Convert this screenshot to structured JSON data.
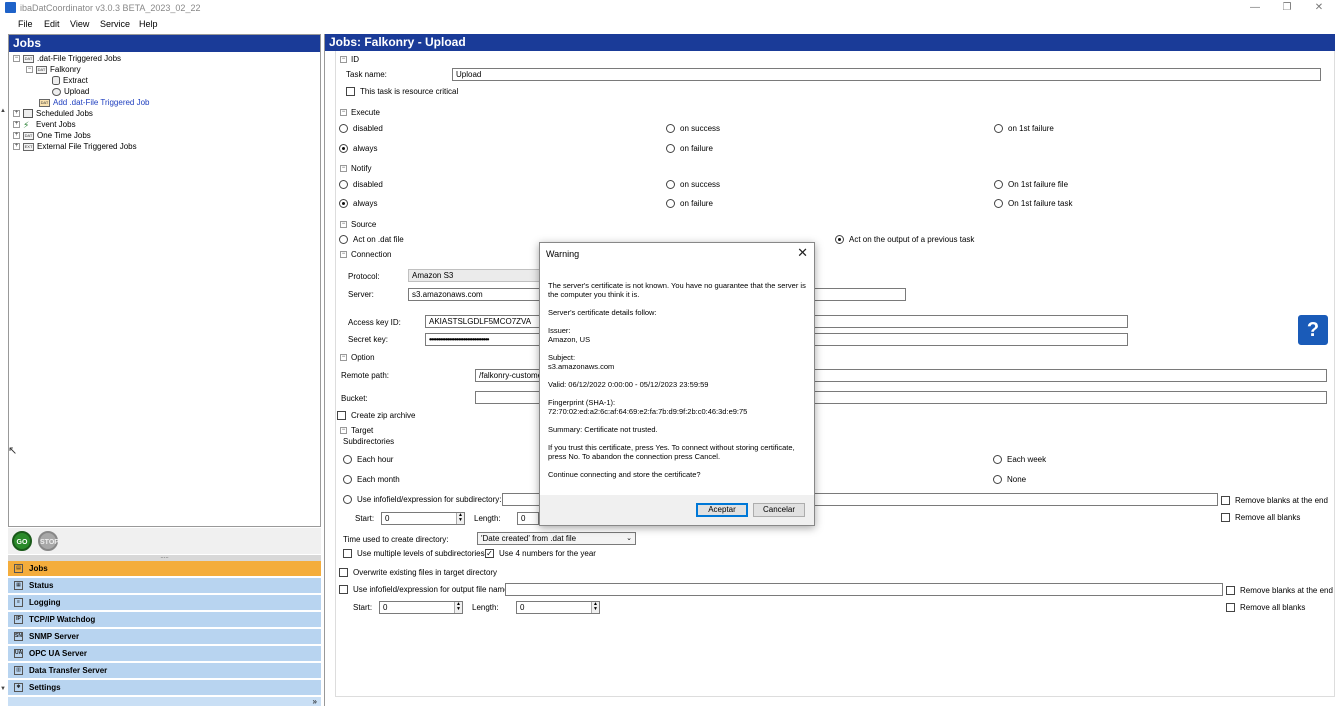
{
  "window": {
    "title": "ibaDatCoordinator v3.0.3 BETA_2023_02_22",
    "minimize": "—",
    "maximize": "❐",
    "close": "✕"
  },
  "menu": [
    "File",
    "Edit",
    "View",
    "Service",
    "Help"
  ],
  "left": {
    "header": "Jobs",
    "tree": [
      {
        "label": ".dat-File Triggered Jobs",
        "icon": "DAT"
      },
      {
        "label": "Falkonry",
        "icon": "DAT"
      },
      {
        "label": "Extract",
        "icon": ""
      },
      {
        "label": "Upload",
        "icon": ""
      },
      {
        "label": "Add .dat-File Triggered Job",
        "icon": "DAT"
      },
      {
        "label": "Scheduled Jobs",
        "icon": ""
      },
      {
        "label": "Event Jobs",
        "icon": ""
      },
      {
        "label": "One Time Jobs",
        "icon": "DAT"
      },
      {
        "label": "External File Triggered Jobs",
        "icon": "EXT"
      }
    ],
    "go_label": "GO",
    "stop_label": "STOP",
    "nav": [
      {
        "label": "Jobs"
      },
      {
        "label": "Status"
      },
      {
        "label": "Logging"
      },
      {
        "label": "TCP/IP Watchdog"
      },
      {
        "label": "SNMP Server"
      },
      {
        "label": "OPC UA Server"
      },
      {
        "label": "Data Transfer Server"
      },
      {
        "label": "Settings"
      }
    ],
    "more": "»"
  },
  "right": {
    "header": "Jobs: Falkonry - Upload",
    "id": {
      "title": "ID",
      "task_name_label": "Task name:",
      "task_name_value": "Upload",
      "resource_critical": "This task is resource critical"
    },
    "execute": {
      "title": "Execute",
      "disabled": "disabled",
      "on_success": "on success",
      "on_1st_failure": "on 1st failure",
      "always": "always",
      "on_failure": "on failure"
    },
    "notify": {
      "title": "Notify",
      "disabled": "disabled",
      "on_success": "on success",
      "on_1st_failure_file": "On 1st failure file",
      "always": "always",
      "on_failure": "on failure",
      "on_1st_failure_task": "On 1st failure task"
    },
    "source": {
      "title": "Source",
      "act_on_dat": "Act on .dat file",
      "act_on_output": "Act on the output of a previous task"
    },
    "connection": {
      "title": "Connection",
      "protocol_label": "Protocol:",
      "protocol_value": "Amazon S3",
      "server_label": "Server:",
      "server_value": "s3.amazonaws.com",
      "access_key_label": "Access key ID:",
      "access_key_value": "AKIASTSLGDLF5MCO7ZVA",
      "secret_key_label": "Secret key:",
      "secret_key_value": "•••••••••••••••••••••••••••••••••"
    },
    "option": {
      "title": "Option",
      "remote_path_label": "Remote path:",
      "remote_path_value": "/falkonry-customer",
      "bucket_label": "Bucket:",
      "zip": "Create zip archive"
    },
    "target": {
      "title": "Target",
      "subdirectories": "Subdirectories",
      "each_hour": "Each hour",
      "each_week": "Each week",
      "each_month": "Each month",
      "none": "None",
      "use_infofield_subdir": "Use infofield/expression for subdirectory:",
      "remove_blanks_end": "Remove blanks at the end",
      "remove_all_blanks": "Remove all blanks",
      "start_label": "Start:",
      "start_value": "0",
      "length_label": "Length:",
      "length_value": "0",
      "time_used_label": "Time used to create directory:",
      "time_used_value": "'Date created' from .dat file",
      "multi_levels": "Use multiple levels of subdirectories",
      "four_numbers": "Use 4 numbers for the year",
      "overwrite": "Overwrite existing files in target directory",
      "use_infofield_output": "Use infofield/expression for output file name:",
      "remove_blanks_end2": "Remove blanks at the end",
      "remove_all_blanks2": "Remove all blanks",
      "start2_value": "0",
      "length2_value": "0"
    },
    "help": "?"
  },
  "dialog": {
    "title": "Warning",
    "close": "✕",
    "p1": "The server's certificate is not known. You have no guarantee that the server is the computer you think it is.",
    "p2": "Server's certificate details follow:",
    "p3": "Issuer:\nAmazon, US",
    "p4": "Subject:\ns3.amazonaws.com",
    "p5": "Valid: 06/12/2022 0:00:00 - 05/12/2023 23:59:59",
    "p6": "Fingerprint (SHA-1):\n72:70:02:ed:a2:6c:af:64:69:e2:fa:7b:d9:9f:2b:c0:46:3d:e9:75",
    "p7": "Summary: Certificate not trusted.",
    "p8": "If you trust this certificate, press Yes. To connect without storing certificate, press No. To abandon the connection press Cancel.",
    "p9": "Continue connecting and store the certificate?",
    "accept": "Aceptar",
    "cancel": "Cancelar"
  }
}
